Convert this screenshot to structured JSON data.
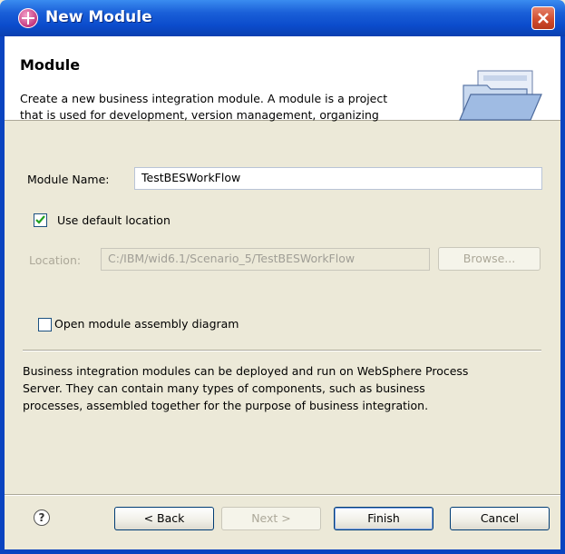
{
  "window": {
    "title": "New Module",
    "colors": {
      "titlebar": "#0b4ccc",
      "close": "#cf4a2c",
      "body": "#ece9d8"
    }
  },
  "header": {
    "title": "Module",
    "description_lines": [
      "Create a new business integration module. A module is a project",
      "that is used for development, version management, organizing"
    ],
    "banner_icon": "open-folder-icon"
  },
  "form": {
    "module_name_label": "Module Name:",
    "module_name_value": "TestBESWorkFlow",
    "use_default_location_label": "Use default location",
    "use_default_location_checked": true,
    "location_label": "Location:",
    "location_value": "C:/IBM/wid6.1/Scenario_5/TestBESWorkFlow",
    "browse_label": "Browse...",
    "open_assembly_label": "Open module assembly diagram",
    "open_assembly_checked": false
  },
  "info": {
    "lines": [
      "Business integration modules can be deployed and run on WebSphere Process",
      "Server. They can contain many types of components, such as business",
      "processes, assembled together for the purpose of business integration."
    ]
  },
  "footer": {
    "help_icon": "help-icon",
    "back_label": "< Back",
    "next_label": "Next >",
    "finish_label": "Finish",
    "cancel_label": "Cancel"
  }
}
